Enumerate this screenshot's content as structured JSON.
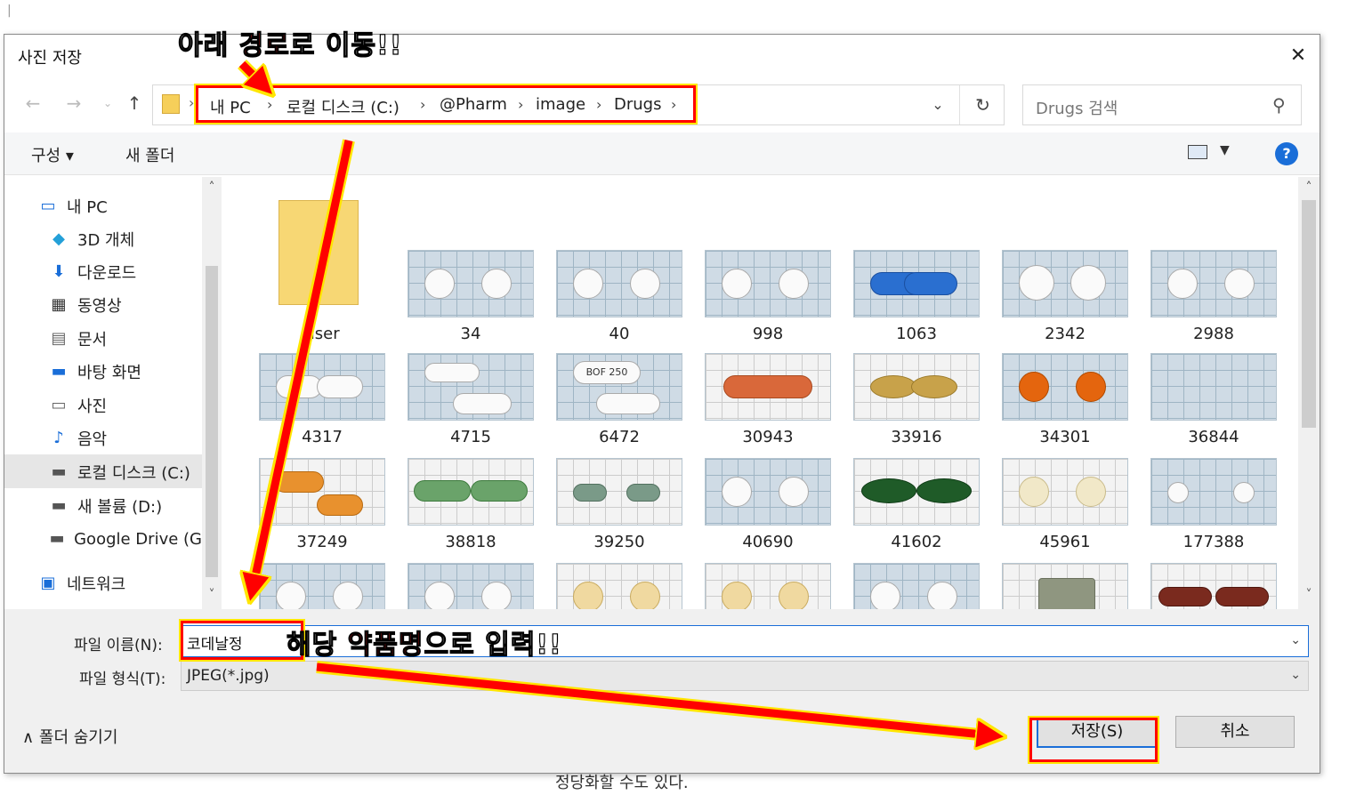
{
  "background": {
    "bottom_text": "정당화할 수도 있다."
  },
  "dialog": {
    "title": "사진 저장",
    "close_icon": "close-icon"
  },
  "address": {
    "crumbs": [
      "내 PC",
      "로컬 디스크 (C:)",
      "@Pharm",
      "image",
      "Drugs"
    ]
  },
  "search": {
    "placeholder": "Drugs 검색"
  },
  "toolbar": {
    "organize": "구성 ▾",
    "new_folder": "새 폴더"
  },
  "nav": {
    "items": [
      {
        "label": "내 PC",
        "icon": "computer-icon"
      },
      {
        "label": "3D 개체",
        "icon": "cube-icon"
      },
      {
        "label": "다운로드",
        "icon": "download-icon"
      },
      {
        "label": "동영상",
        "icon": "film-icon"
      },
      {
        "label": "문서",
        "icon": "document-icon"
      },
      {
        "label": "바탕 화면",
        "icon": "desktop-icon"
      },
      {
        "label": "사진",
        "icon": "picture-icon"
      },
      {
        "label": "음악",
        "icon": "music-icon"
      },
      {
        "label": "로컬 디스크 (C:)",
        "icon": "drive-icon",
        "selected": true
      },
      {
        "label": "새 볼륨 (D:)",
        "icon": "drive-icon"
      },
      {
        "label": "Google Drive (G",
        "icon": "drive-icon"
      },
      {
        "label": "네트워크",
        "icon": "network-icon"
      }
    ]
  },
  "files": {
    "folder": "user",
    "rows": [
      [
        "34",
        "40",
        "998",
        "1063",
        "2342",
        "2988"
      ],
      [
        "4317",
        "4715",
        "6472",
        "30943",
        "33916",
        "34301",
        "36844"
      ],
      [
        "37249",
        "38818",
        "39250",
        "40690",
        "41602",
        "45961",
        "177388"
      ]
    ],
    "thumb_labels": [
      "BOF 250"
    ]
  },
  "form": {
    "filename_label": "파일 이름(N):",
    "filename_value": "코데날정",
    "filetype_label": "파일 형식(T):",
    "filetype_value": "JPEG(*.jpg)",
    "hide_folders": "폴더 숨기기",
    "save": "저장(S)",
    "cancel": "취소"
  },
  "annotations": {
    "top_pre": "아래 ",
    "top_red": "경로",
    "top_post": "로 이동!!",
    "mid_pre": "해당 ",
    "mid_red": "약품명",
    "mid_post": "으로 입력!!"
  },
  "colors": {
    "accent": "#1a6ed8",
    "highlight": "#ff0000",
    "glow": "#ffe600"
  }
}
